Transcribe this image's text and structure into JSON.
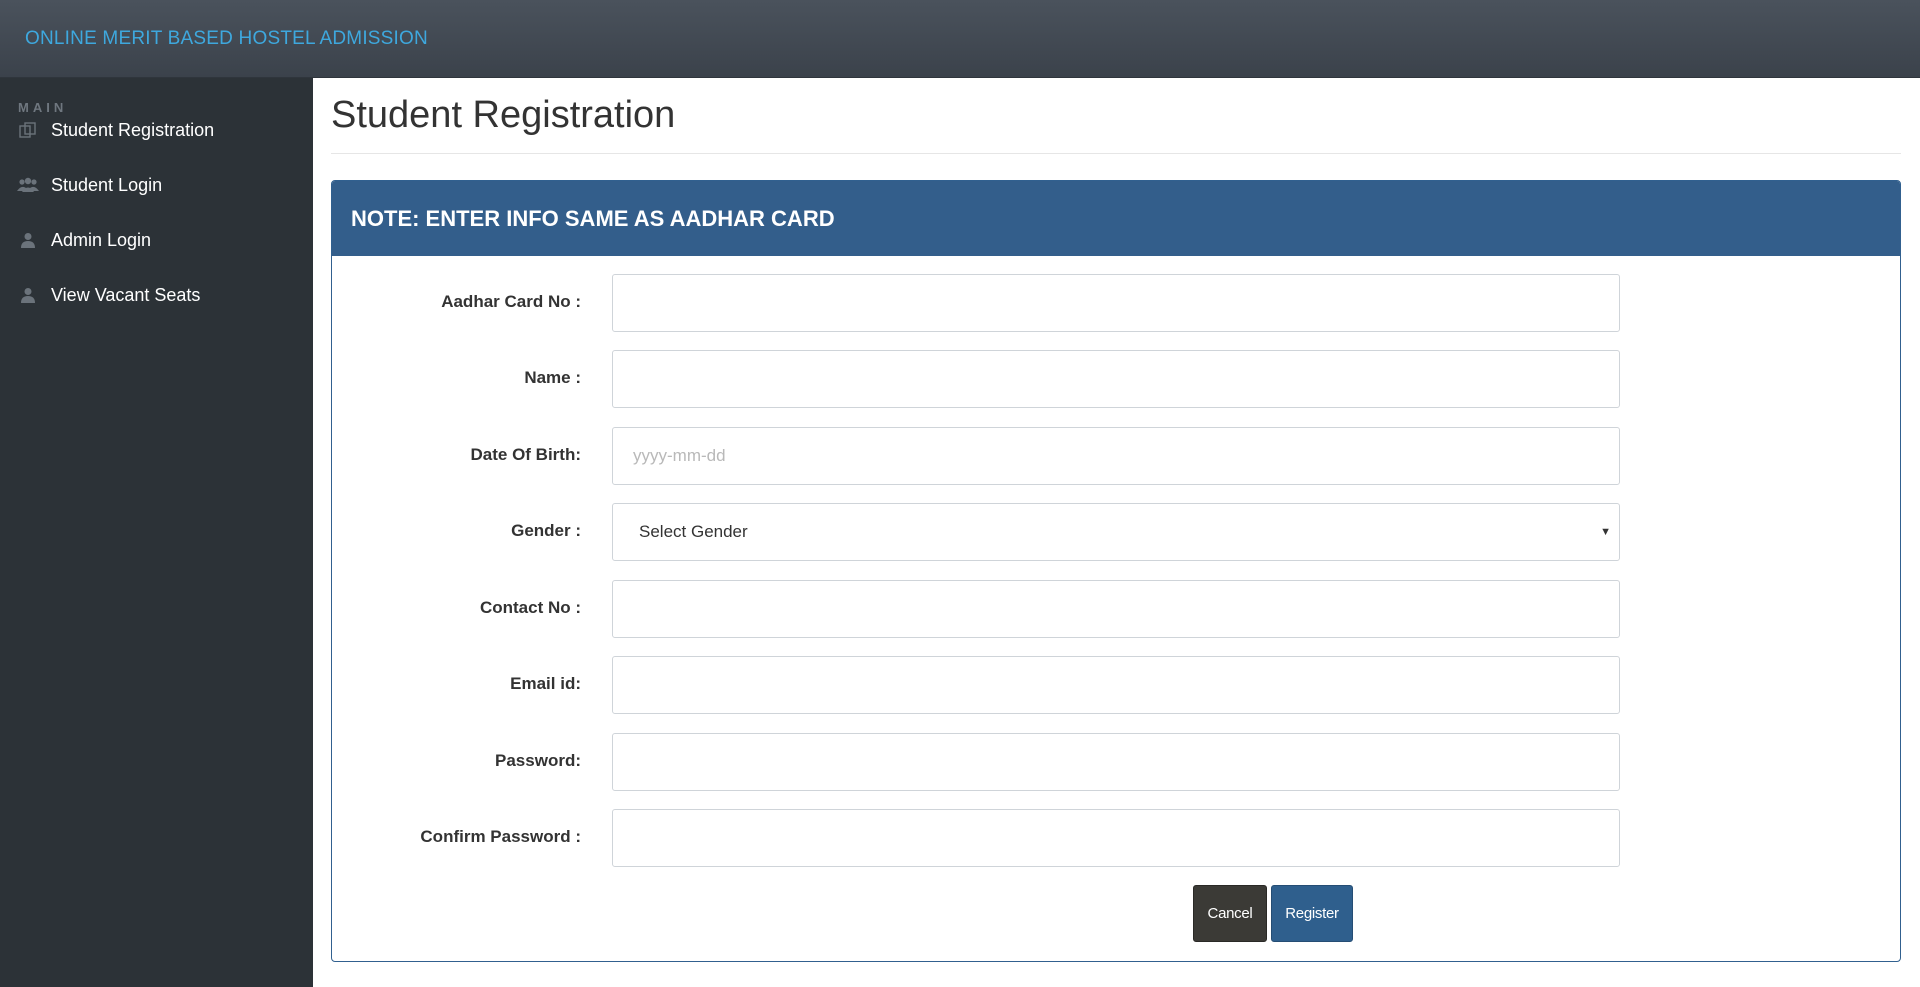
{
  "header": {
    "brand": "ONLINE MERIT BASED HOSTEL ADMISSION"
  },
  "sidebar": {
    "heading": "MAIN",
    "items": [
      {
        "label": "Student Registration",
        "icon": "copy-icon"
      },
      {
        "label": "Student Login",
        "icon": "users-icon"
      },
      {
        "label": "Admin Login",
        "icon": "user-icon"
      },
      {
        "label": "View Vacant Seats",
        "icon": "user-icon"
      }
    ]
  },
  "main": {
    "title": "Student Registration",
    "panel_heading": "NOTE: ENTER INFO SAME AS AADHAR CARD",
    "form": {
      "aadhar_label": "Aadhar Card No :",
      "aadhar_value": "",
      "name_label": "Name :",
      "name_value": "",
      "dob_label": "Date Of Birth:",
      "dob_placeholder": "yyyy-mm-dd",
      "gender_label": "Gender :",
      "gender_selected": "Select Gender",
      "contact_label": "Contact No :",
      "contact_value": "",
      "email_label": "Email id:",
      "email_value": "",
      "password_label": "Password:",
      "password_value": "",
      "confirm_label": "Confirm Password :",
      "confirm_value": ""
    },
    "buttons": {
      "cancel": "Cancel",
      "register": "Register"
    }
  },
  "colors": {
    "topbar": "#3f464f",
    "brand": "#3ea8de",
    "sidebar": "#2c3237",
    "panel_heading": "#335e8b",
    "cancel_button": "#3b3a36",
    "register_button": "#2f5f8d"
  }
}
